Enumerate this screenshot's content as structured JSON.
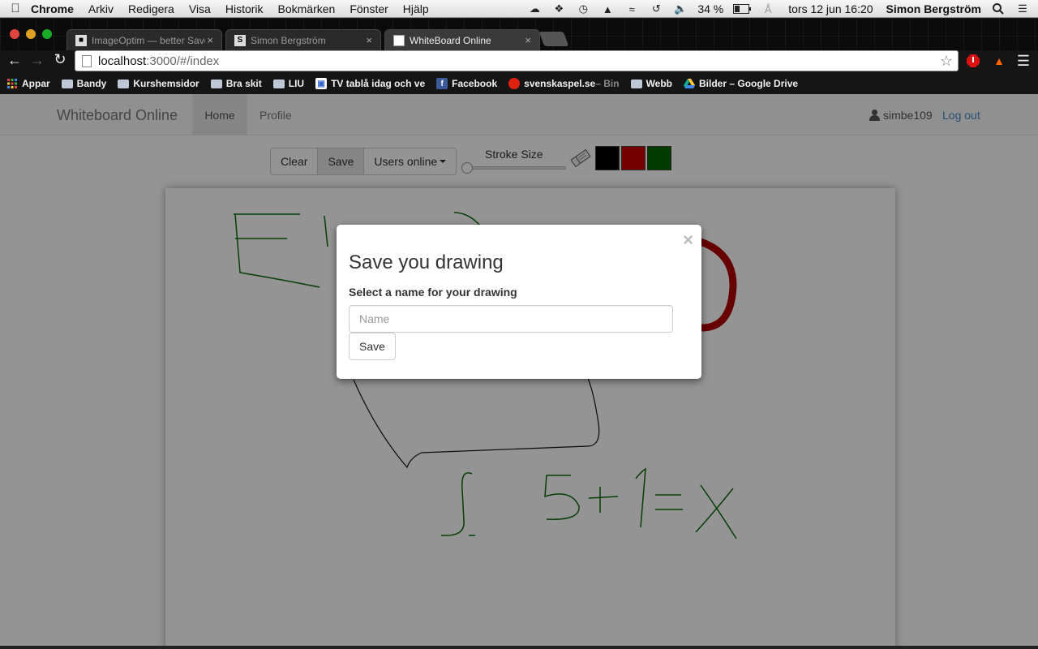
{
  "menubar": {
    "app_name": "Chrome",
    "menus": [
      "Arkiv",
      "Redigera",
      "Visa",
      "Historik",
      "Bokmärken",
      "Fönster",
      "Hjälp"
    ],
    "battery": "34 %",
    "datetime": "tors 12 jun  16:20",
    "user": "Simon Bergström"
  },
  "tabs": [
    {
      "title": "ImageOptim — better Save",
      "active": false
    },
    {
      "title": "Simon Bergström",
      "active": false,
      "favicon_letter": "S"
    },
    {
      "title": "WhiteBoard Online",
      "active": true
    }
  ],
  "address": {
    "host": "localhost",
    "path": ":3000/#/index"
  },
  "bookmarks": [
    {
      "label": "Appar",
      "icon": "apps-grid-icon"
    },
    {
      "label": "Bandy",
      "icon": "folder-icon"
    },
    {
      "label": "Kurshemsidor",
      "icon": "folder-icon"
    },
    {
      "label": "Bra skit",
      "icon": "folder-icon"
    },
    {
      "label": "LIU",
      "icon": "folder-icon"
    },
    {
      "label": "TV tablå idag och ve",
      "icon": "tv-icon"
    },
    {
      "label": "Facebook",
      "icon": "facebook-icon"
    },
    {
      "label": "svenskaspel.se",
      "suffix": " – Bin",
      "icon": "svenskaspel-icon"
    },
    {
      "label": "Webb",
      "icon": "folder-icon"
    },
    {
      "label": "Bilder – Google Drive",
      "icon": "drive-icon"
    }
  ],
  "app": {
    "brand": "Whiteboard Online",
    "nav": {
      "home": "Home",
      "profile": "Profile"
    },
    "username": "simbe109",
    "logout": "Log out",
    "toolbar": {
      "clear": "Clear",
      "save": "Save",
      "users_online": "Users online",
      "stroke_label": "Stroke Size",
      "stroke_value": 0
    },
    "colors": [
      "#000000",
      "#cc0000",
      "#006600"
    ]
  },
  "modal": {
    "close": "×",
    "title": "Save you drawing",
    "label": "Select a name for your drawing",
    "input_placeholder": "Name",
    "input_value": "",
    "save": "Save"
  }
}
